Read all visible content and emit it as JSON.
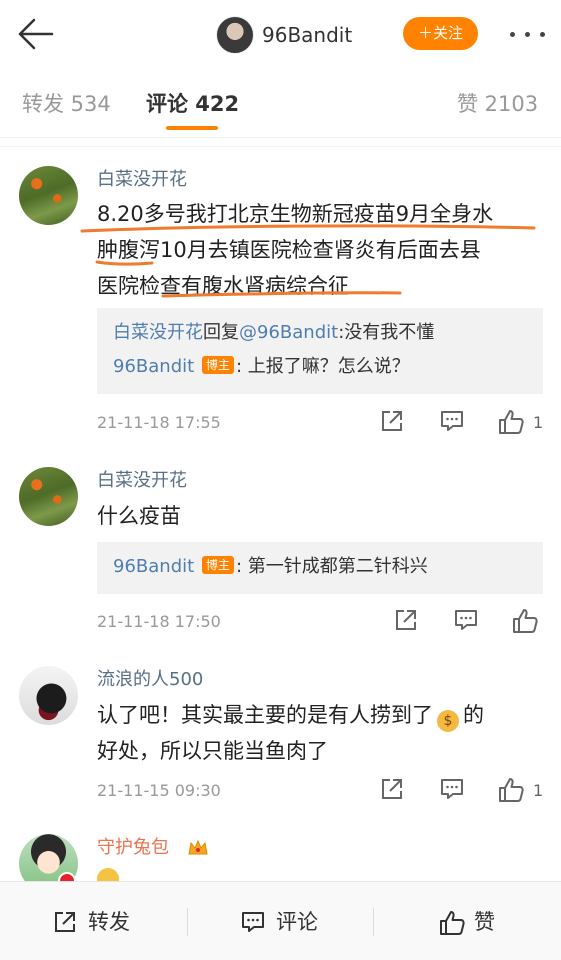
{
  "header": {
    "username": "96Bandit",
    "follow_label": "＋关注"
  },
  "tabs": [
    {
      "label": "转发 534"
    },
    {
      "label": "评论 422"
    },
    {
      "label": "赞 2103"
    }
  ],
  "comments": [
    {
      "author": "白菜没开花",
      "lines": [
        "8.20多号我打北京生物新冠疫苗9月全身水",
        "肿腹泻10月去镇医院检查肾炎有后面去县",
        "医院检查有腹水肾病综合征"
      ],
      "reply": {
        "line1_author": "白菜没开花",
        "line1_mid": "回复",
        "line1_at": "@96Bandit",
        "line1_text": ":没有我不懂",
        "line2_author": "96Bandit",
        "line2_tag": "博主",
        "line2_text": ": 上报了嘛？怎么说？"
      },
      "time": "21-11-18 17:55",
      "likes": "1"
    },
    {
      "author": "白菜没开花",
      "lines": [
        "什么疫苗"
      ],
      "reply": {
        "line1_author": "96Bandit",
        "line1_tag": "博主",
        "line1_text": ": 第一针成都第二针科兴"
      },
      "time": "21-11-18 17:50",
      "likes": ""
    },
    {
      "author": "流浪的人500",
      "line1_a": "认了吧！其实最主要的是有人捞到了",
      "line1_b": "的",
      "line2": "好处，所以只能当鱼肉了",
      "emoji": "$",
      "time": "21-11-15 09:30",
      "likes": "1"
    },
    {
      "author": "守护兔包"
    }
  ],
  "bottom_bar": {
    "repost": "转发",
    "comment": "评论",
    "like": "赞"
  },
  "colors": {
    "accent": "#ff8200",
    "link": "#507daf",
    "underline_annotation": "#f07a2e"
  }
}
